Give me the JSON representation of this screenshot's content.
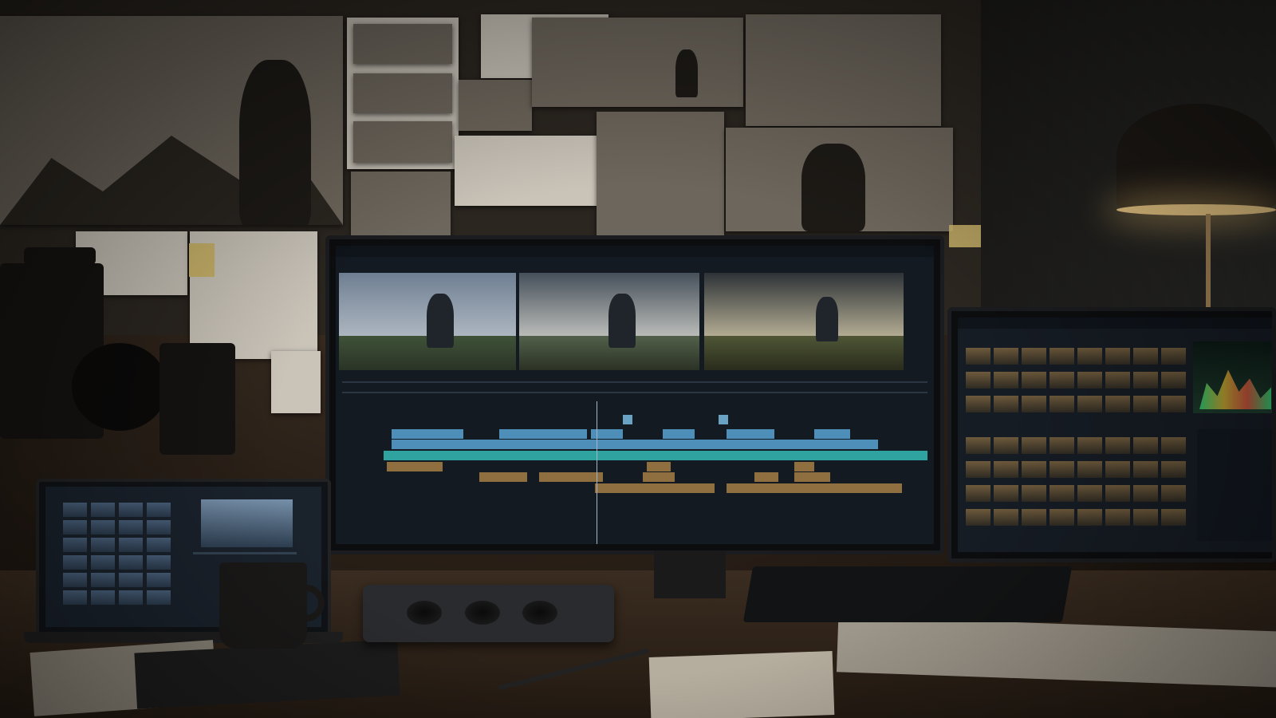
{
  "scene": {
    "description_tag": "",
    "colors": {
      "lamp_glow": "#f2cf8a",
      "timeline_teal": "#2fa3a0",
      "timeline_blue": "#4d8fb8",
      "timeline_amber": "#8f6f3f"
    }
  }
}
